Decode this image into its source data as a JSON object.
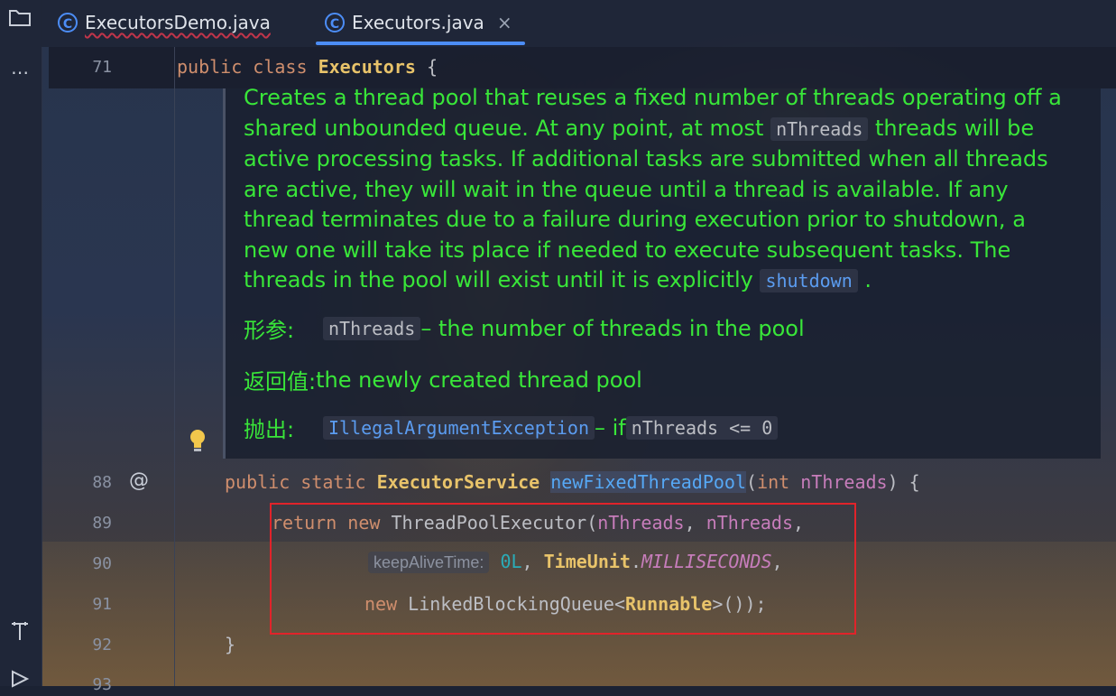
{
  "tabs": [
    {
      "label": "ExecutorsDemo.java",
      "icon": "class-run-icon"
    },
    {
      "label": "Executors.java",
      "icon": "class-icon",
      "close": "×"
    }
  ],
  "lines": {
    "l71": "71",
    "l88": "88",
    "l89": "89",
    "l90": "90",
    "l91": "91",
    "l92": "92",
    "l93": "93"
  },
  "code71": {
    "kw1": "public",
    "kw2": "class",
    "cls": "Executors",
    "brace": "{"
  },
  "doc": {
    "p1a": "Creates a thread pool that reuses a fixed number of threads operating off a shared unbounded queue. At any point, at most ",
    "chip1": "nThreads",
    "p1b": " threads will be active processing tasks. If additional tasks are submitted when all threads are active, they will wait in the queue until a thread is available. If any thread terminates due to a failure during execution prior to shutdown, a new one will take its place if needed to execute subsequent tasks. The threads in the pool will exist until it is explicitly ",
    "chip2": "shutdown",
    "p1c": " .",
    "params_tag": "形参:",
    "params_chip": "nThreads",
    "params_text": " – the number of threads in the pool",
    "returns_tag": "返回值:",
    "returns_text": " the newly created thread pool",
    "throws_tag": "抛出:",
    "throws_chip": "IllegalArgumentException",
    "throws_text": " – if ",
    "throws_chip2": "nThreads <= 0"
  },
  "code88": {
    "kw1": "public",
    "kw2": "static",
    "type": "ExecutorService",
    "fn": "newFixedThreadPool",
    "p1": "(",
    "kwint": "int",
    "param": "nThreads",
    "p2": ") {"
  },
  "code89": {
    "kw": "return",
    "kwnew": "new",
    "cls": "ThreadPoolExecutor",
    "p1": "(",
    "a1": "nThreads",
    "c1": ", ",
    "a2": "nThreads",
    "c2": ","
  },
  "code90": {
    "hint": "keepAliveTime:",
    "num": "0L",
    "c1": ", ",
    "cls": "TimeUnit",
    "dot": ".",
    "const": "MILLISECONDS",
    "c2": ","
  },
  "code91": {
    "kwnew": "new",
    "cls": "LinkedBlockingQueue",
    "lt": "<",
    "generic": "Runnable",
    "rest": ">());"
  },
  "code92": {
    "brace": "}"
  },
  "colors": {
    "accent": "#4c8df6",
    "doc_text": "#39e639",
    "highlight_box": "#e1232a"
  }
}
